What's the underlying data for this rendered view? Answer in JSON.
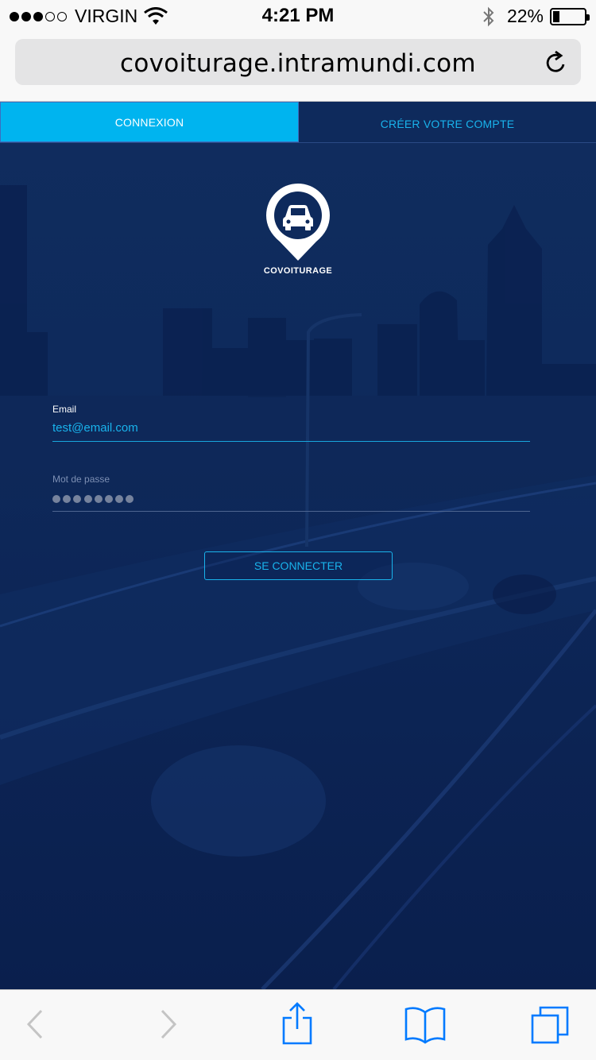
{
  "status_bar": {
    "carrier": "VIRGIN",
    "time": "4:21 PM",
    "battery": "22%",
    "battery_level": 0.22
  },
  "browser": {
    "url": "covoiturage.intramundi.com"
  },
  "tabs": [
    {
      "label": "CONNEXION",
      "active": true
    },
    {
      "label": "CRÉER VOTRE COMPTE",
      "active": false
    }
  ],
  "logo": {
    "text": "COVOITURAGE",
    "icon": "car-pin-icon"
  },
  "form": {
    "email_label": "Email",
    "email_value": "test@email.com",
    "password_label": "Mot de passe",
    "password_mask_count": 8,
    "submit_label": "SE CONNECTER"
  },
  "toolbar": {
    "icons": [
      "back-icon",
      "forward-icon",
      "share-icon",
      "bookmarks-icon",
      "tabs-icon"
    ]
  },
  "colors": {
    "accent": "#00b4ef",
    "link": "#19b3ec",
    "background": "#0e2a5c",
    "ios_blue": "#007aff"
  }
}
